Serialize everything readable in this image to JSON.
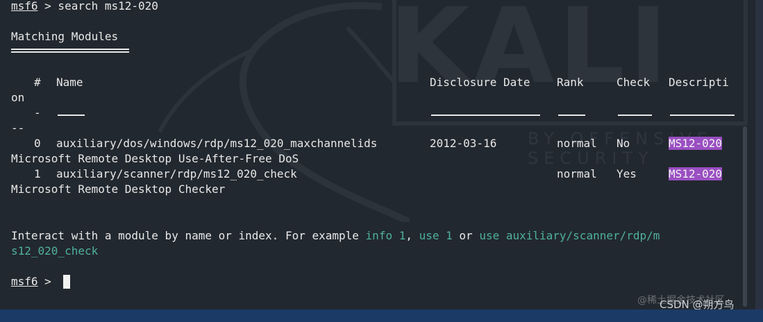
{
  "window": {
    "background_color": "#22282f",
    "accent_link": "#4fb0a0",
    "highlight": "#9a4fc2"
  },
  "watermark": {
    "main": "KALI",
    "sub": "BY OFFENSIVE SECURITY"
  },
  "terminal": {
    "prompt1": {
      "shell": "msf6",
      "rest": " > search ms12-020"
    },
    "heading": "Matching Modules",
    "header": {
      "num": "#",
      "name": "Name",
      "date": "Disclosure Date",
      "rank": "Rank",
      "check": "Check",
      "desc": "Descripti"
    },
    "header_wrap": "on",
    "dash_num": "-",
    "dash_wrap": "--",
    "rows": [
      {
        "num": "0",
        "name": "auxiliary/dos/windows/rdp/ms12_020_maxchannelids",
        "date": "2012-03-16",
        "rank": "normal",
        "check": "No",
        "desc": "MS12-020",
        "desc_wrap": "Microsoft Remote Desktop Use-After-Free DoS"
      },
      {
        "num": "1",
        "name": "auxiliary/scanner/rdp/ms12_020_check",
        "date": "",
        "rank": "normal",
        "check": "Yes",
        "desc": "MS12-020",
        "desc_wrap": "Microsoft Remote Desktop Checker"
      }
    ],
    "interact": {
      "prefix": "Interact with a module by name or index. For example ",
      "link1": "info 1",
      "sep1": ", ",
      "link2": "use 1",
      "sep2": " or ",
      "link3": "use auxiliary/scanner/rdp/m",
      "link3_wrap": "s12_020_check"
    },
    "prompt2": {
      "shell": "msf6",
      "rest": " > "
    }
  },
  "footer": {
    "juejin": "@稀土掘金技术社区",
    "csdn": "CSDN @朔方鸟"
  }
}
